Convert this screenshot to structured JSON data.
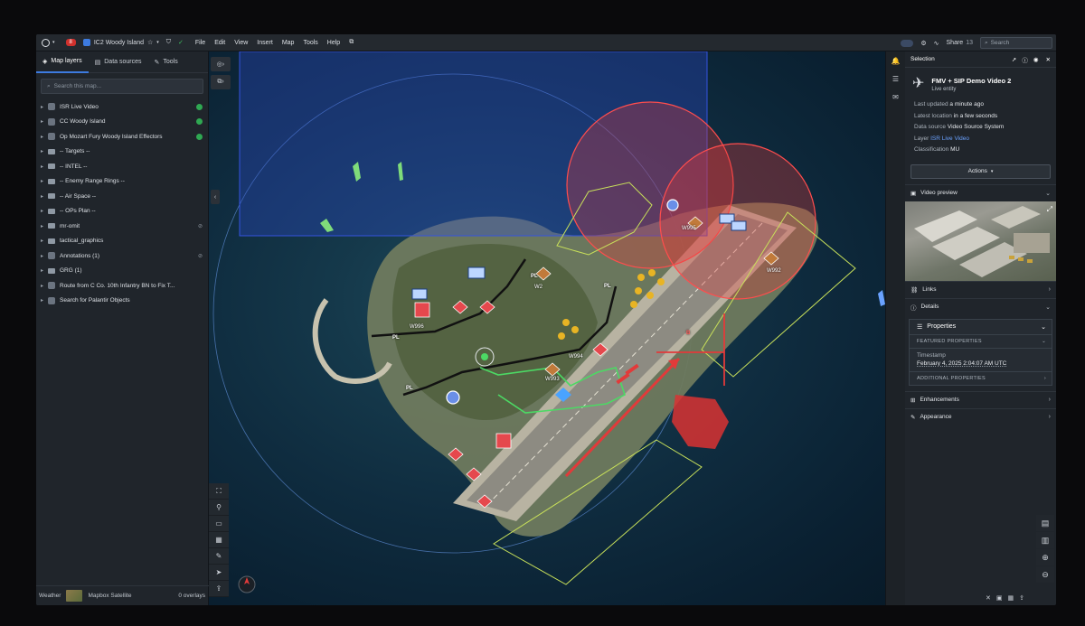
{
  "topbar": {
    "notifications_badge": "8",
    "map_title": "IC2 Woody Island",
    "menu": [
      "File",
      "Edit",
      "View",
      "Insert",
      "Map",
      "Tools",
      "Help"
    ],
    "share_label": "Share",
    "share_count": "13",
    "search_placeholder": "Search"
  },
  "left_panel": {
    "tabs": [
      {
        "label": "Map layers",
        "icon": "layers-icon"
      },
      {
        "label": "Data sources",
        "icon": "database-icon"
      },
      {
        "label": "Tools",
        "icon": "wrench-icon"
      }
    ],
    "search_placeholder": "Search this map...",
    "layers": [
      {
        "label": "ISR Live Video",
        "type": "layer",
        "status": "green"
      },
      {
        "label": "CC Woody Island",
        "type": "layer",
        "status": "green"
      },
      {
        "label": "Op Mozart Fury Woody Island Effectors",
        "type": "layer",
        "status": "green"
      },
      {
        "label": "-- Targets --",
        "type": "folder"
      },
      {
        "label": "-- INTEL --",
        "type": "folder"
      },
      {
        "label": "-- Enemy Range Rings --",
        "type": "folder"
      },
      {
        "label": "-- Air Space --",
        "type": "folder"
      },
      {
        "label": "-- OPs Plan --",
        "type": "folder"
      },
      {
        "label": "mr-omit",
        "type": "folder",
        "hidden": true
      },
      {
        "label": "tactical_graphics",
        "type": "folder"
      },
      {
        "label": "Annotations (1)",
        "type": "layer",
        "hidden": true
      },
      {
        "label": "GRG (1)",
        "type": "folder"
      },
      {
        "label": "Route from C Co. 10th Infantry BN to Fix T...",
        "type": "layer"
      },
      {
        "label": "Search for Palantir Objects",
        "type": "layer"
      }
    ],
    "basemap_label": "Weather",
    "basemap_name": "Mapbox Satellite",
    "overlays": "0 overlays"
  },
  "map": {
    "labels": [
      "PL",
      "PL",
      "PL",
      "PL",
      "W995",
      "W992",
      "W994",
      "W993",
      "W996",
      "W2"
    ],
    "route_marker": "B"
  },
  "selection": {
    "header": "Selection",
    "entity_title": "FMV + SIP Demo Video 2",
    "entity_subtitle": "Live entity",
    "fields": [
      {
        "key": "Last updated",
        "value": "a minute ago"
      },
      {
        "key": "Latest location",
        "value": "in a few seconds"
      },
      {
        "key": "Data source",
        "value": "Video Source System"
      },
      {
        "key": "Layer",
        "value": "ISR Live Video",
        "link": true
      },
      {
        "key": "Classification",
        "value": "MU"
      }
    ],
    "actions_label": "Actions",
    "video_preview_label": "Video preview",
    "links_label": "Links",
    "details_label": "Details",
    "properties_label": "Properties",
    "featured_properties_label": "FEATURED PROPERTIES",
    "timestamp_key": "Timestamp",
    "timestamp_value": "February 4, 2025 2:04:07 AM UTC",
    "additional_properties_label": "ADDITIONAL PROPERTIES",
    "enhancements_label": "Enhancements",
    "appearance_label": "Appearance"
  },
  "colors": {
    "accent": "#3d7be0",
    "range_ring": "#e23a3a",
    "airspace": "#2f4bd6",
    "boundary": "#c8e05a",
    "route_green": "#4cd964"
  }
}
